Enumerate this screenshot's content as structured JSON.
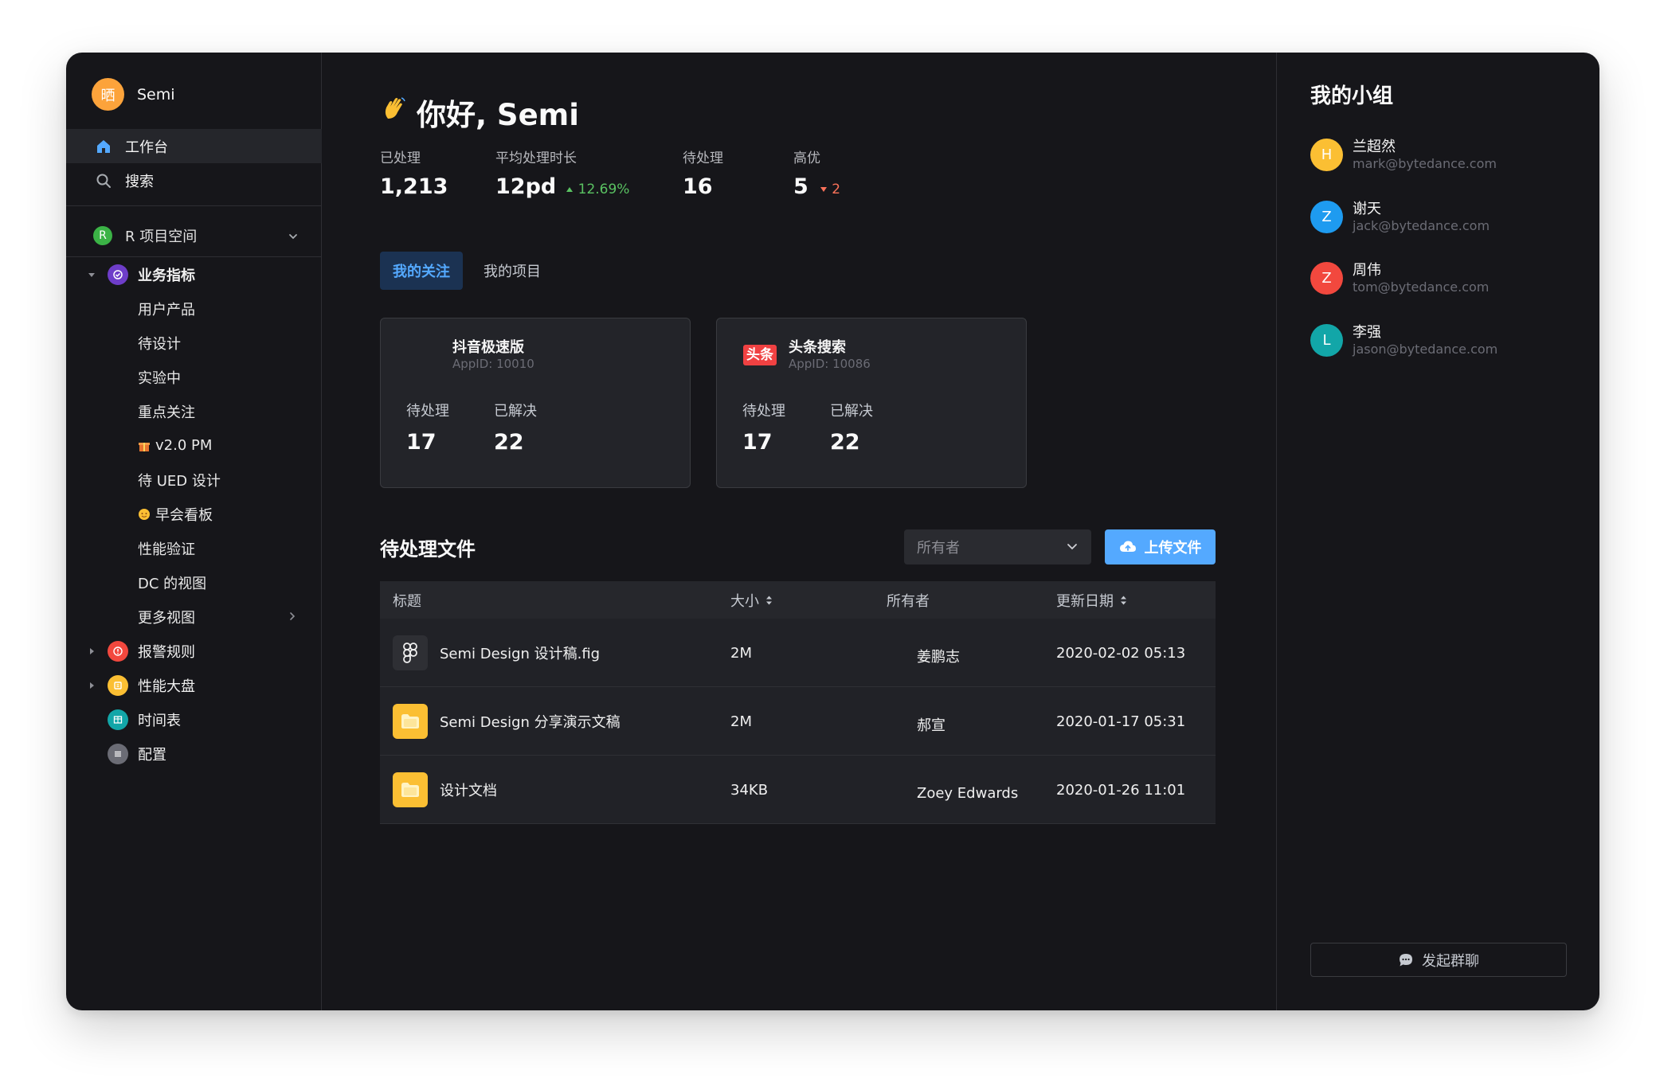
{
  "sidebar": {
    "brand": {
      "avatar": "晒",
      "name": "Semi"
    },
    "nav": [
      {
        "label": "工作台",
        "icon": "home-icon"
      },
      {
        "label": "搜索",
        "icon": "search-icon"
      }
    ],
    "space": {
      "badge": "R",
      "label": "R 项目空间"
    },
    "tree": {
      "metrics": {
        "label": "业务指标",
        "children": [
          "用户产品",
          "待设计",
          "实验中",
          "重点关注",
          "v2.0 PM",
          "待 UED 设计",
          "早会看板",
          "性能验证",
          "DC 的视图",
          "更多视图"
        ]
      },
      "alerts": {
        "label": "报警规则"
      },
      "perf": {
        "label": "性能大盘"
      },
      "schedule": {
        "label": "时间表"
      },
      "config": {
        "label": "配置"
      }
    }
  },
  "main": {
    "greeting": "你好, Semi",
    "stats": [
      {
        "label": "已处理",
        "value": "1,213"
      },
      {
        "label": "平均处理时长",
        "value": "12pd",
        "delta": "12.69%"
      },
      {
        "label": "待处理",
        "value": "16"
      },
      {
        "label": "高优",
        "value": "5",
        "delta": "2"
      }
    ],
    "tabs": [
      "我的关注",
      "我的项目"
    ],
    "cards": [
      {
        "name": "抖音极速版",
        "app_id": "AppID: 10010",
        "pending_label": "待处理",
        "pending": "17",
        "resolved_label": "已解决",
        "resolved": "22"
      },
      {
        "name": "头条搜索",
        "app_id": "AppID: 10086",
        "logo_text": "头条",
        "pending_label": "待处理",
        "pending": "17",
        "resolved_label": "已解决",
        "resolved": "22"
      }
    ],
    "files_section": {
      "title": "待处理文件",
      "owner_placeholder": "所有者",
      "upload_label": "上传文件",
      "columns": [
        "标题",
        "大小",
        "所有者",
        "更新日期"
      ],
      "rows": [
        {
          "title": "Semi Design 设计稿.fig",
          "size": "2M",
          "owner": "姜鹏志",
          "date": "2020-02-02 05:13",
          "icon": "figma-icon"
        },
        {
          "title": "Semi Design 分享演示文稿",
          "size": "2M",
          "owner": "郝宣",
          "date": "2020-01-17 05:31",
          "icon": "folder-icon"
        },
        {
          "title": "设计文档",
          "size": "34KB",
          "owner": "Zoey Edwards",
          "date": "2020-01-26 11:01",
          "icon": "folder-icon"
        }
      ]
    }
  },
  "right": {
    "title": "我的小组",
    "members": [
      {
        "initial": "H",
        "name": "兰超然",
        "email": "mark@bytedance.com",
        "color": "#fbbf33"
      },
      {
        "initial": "Z",
        "name": "谢天",
        "email": "jack@bytedance.com",
        "color": "#1e9bf0"
      },
      {
        "initial": "Z",
        "name": "周伟",
        "email": "tom@bytedance.com",
        "color": "#f2483e"
      },
      {
        "initial": "L",
        "name": "李强",
        "email": "jason@bytedance.com",
        "color": "#12a6a8"
      }
    ],
    "chat_label": "发起群聊"
  },
  "colors": {
    "accent": "#54a9ff",
    "up": "#5ac262",
    "down": "#fc725a",
    "background": "#16161a"
  }
}
